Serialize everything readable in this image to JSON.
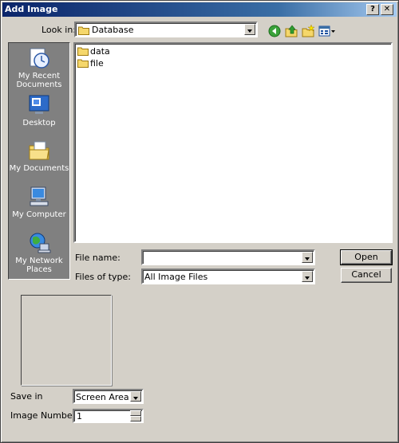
{
  "window": {
    "title": "Add Image",
    "help_button": "?",
    "close_button": "✕"
  },
  "look_in": {
    "label": "Look in:",
    "value": "Database"
  },
  "toolbar": [
    "back-icon",
    "up-folder-icon",
    "new-folder-icon",
    "view-menu-icon"
  ],
  "places": [
    {
      "label": "My Recent Documents",
      "icon": "recent-documents-icon"
    },
    {
      "label": "Desktop",
      "icon": "desktop-icon"
    },
    {
      "label": "My Documents",
      "icon": "my-documents-icon"
    },
    {
      "label": "My Computer",
      "icon": "my-computer-icon"
    },
    {
      "label": "My Network Places",
      "icon": "network-places-icon"
    }
  ],
  "files": [
    {
      "name": "data",
      "icon": "folder-icon"
    },
    {
      "name": "file",
      "icon": "folder-icon"
    }
  ],
  "file_name": {
    "label": "File name:",
    "value": ""
  },
  "file_type": {
    "label": "Files of type:",
    "value": "All Image Files"
  },
  "buttons": {
    "open": "Open",
    "cancel": "Cancel"
  },
  "save_in": {
    "label": "Save in",
    "value": "Screen Area"
  },
  "image_number": {
    "label": "Image Number",
    "value": "1"
  },
  "colors": {
    "title_start": "#0a246a",
    "title_end": "#a6caf0",
    "face": "#d4d0c8",
    "shadow": "#808080"
  }
}
